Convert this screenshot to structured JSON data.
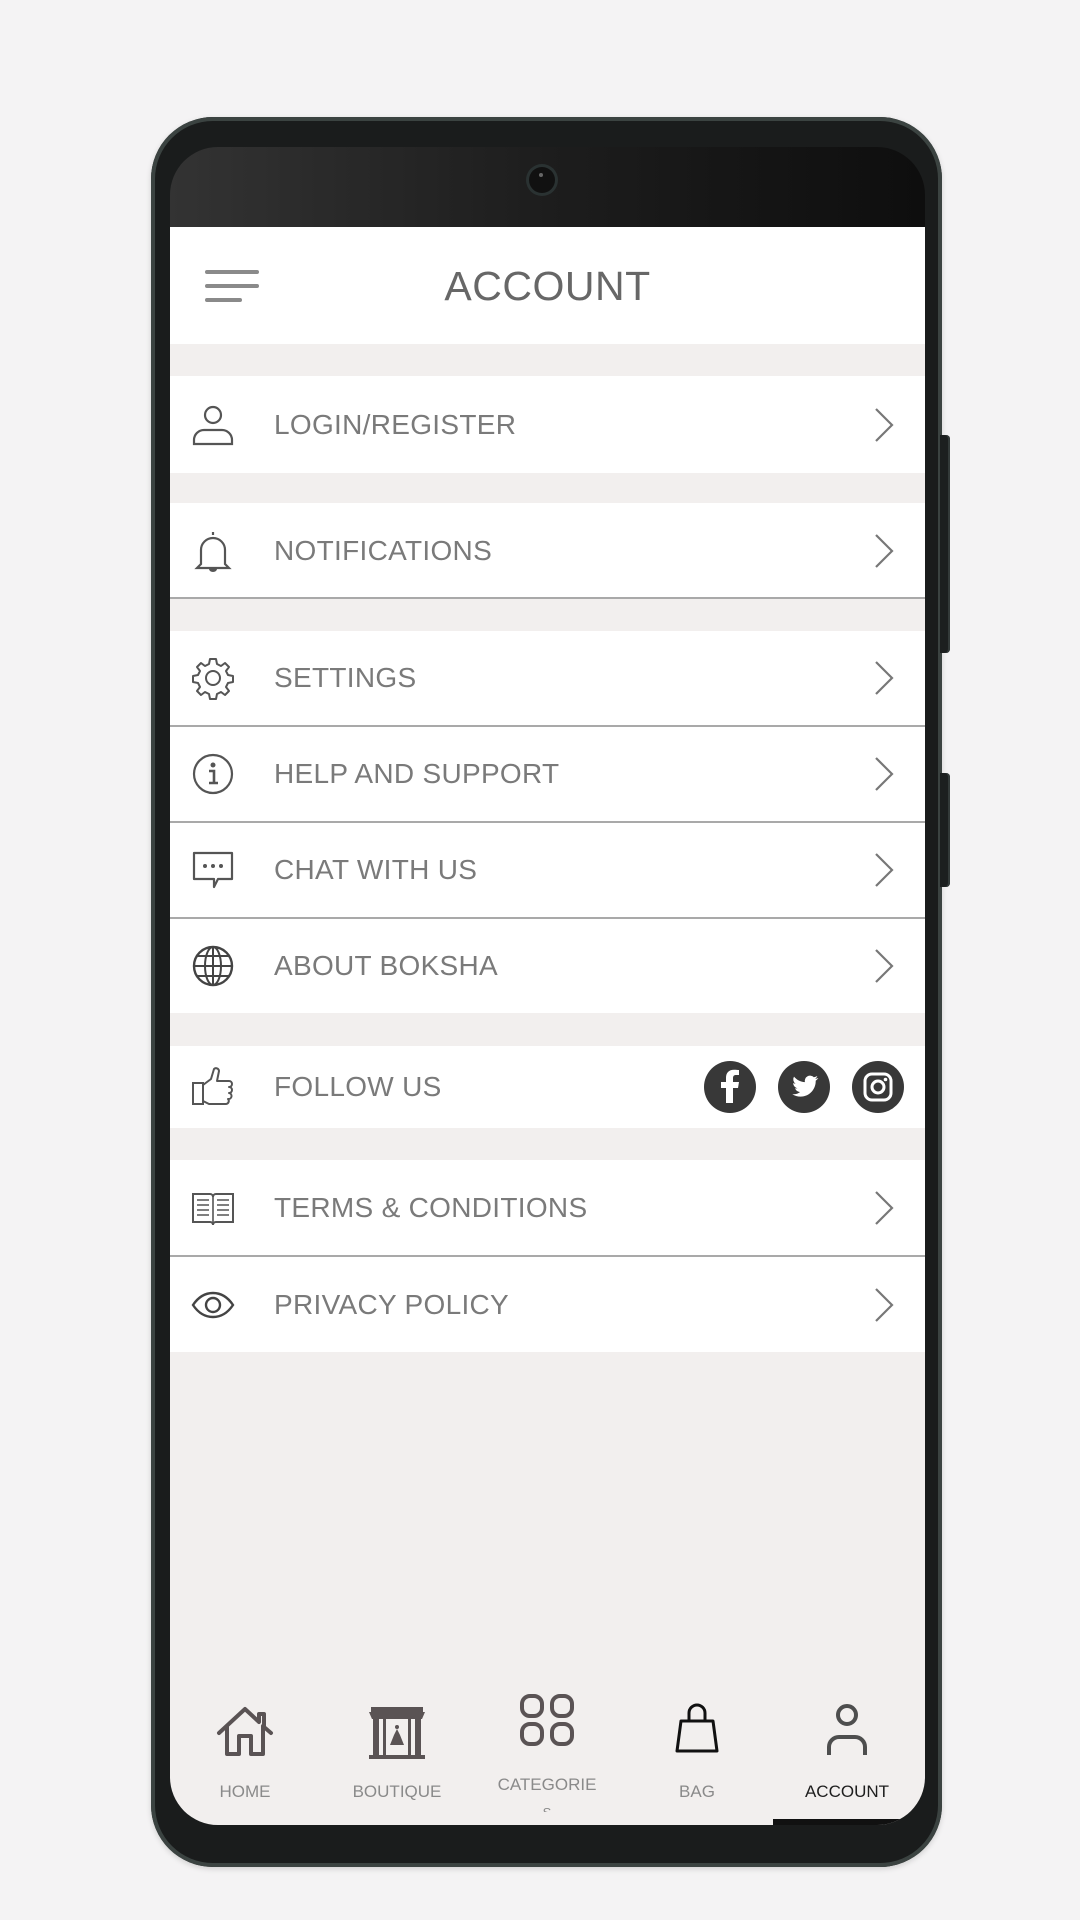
{
  "header": {
    "title": "ACCOUNT",
    "menu_icon": "hamburger-menu-icon"
  },
  "menu": {
    "login": {
      "label": "LOGIN/REGISTER",
      "icon": "user-icon"
    },
    "notifications": {
      "label": "NOTIFICATIONS",
      "icon": "bell-icon"
    },
    "settings": {
      "label": "SETTINGS",
      "icon": "gear-icon"
    },
    "help": {
      "label": "HELP AND SUPPORT",
      "icon": "info-icon"
    },
    "chat": {
      "label": "CHAT WITH US",
      "icon": "chat-bubble-icon"
    },
    "about": {
      "label": "ABOUT BOKSHA",
      "icon": "globe-icon"
    },
    "follow": {
      "label": "FOLLOW US",
      "icon": "thumbs-up-icon",
      "socials": [
        "facebook",
        "twitter",
        "instagram"
      ]
    },
    "terms": {
      "label": "TERMS & CONDITIONS",
      "icon": "book-icon"
    },
    "privacy": {
      "label": "PRIVACY POLICY",
      "icon": "eye-icon"
    }
  },
  "bottom_nav": {
    "items": [
      {
        "label": "HOME",
        "icon": "home-icon"
      },
      {
        "label": "BOUTIQUE",
        "icon": "storefront-icon"
      },
      {
        "label": "CATEGORIE",
        "label_overflow": "S",
        "icon": "grid-icon"
      },
      {
        "label": "BAG",
        "icon": "shopping-bag-icon"
      },
      {
        "label": "ACCOUNT",
        "icon": "user-icon",
        "active": true
      }
    ]
  },
  "colors": {
    "screen_bg": "#f2efee",
    "text": "#7a7a7a",
    "active_nav": "#1e1e1e",
    "social_bg": "#383838"
  }
}
